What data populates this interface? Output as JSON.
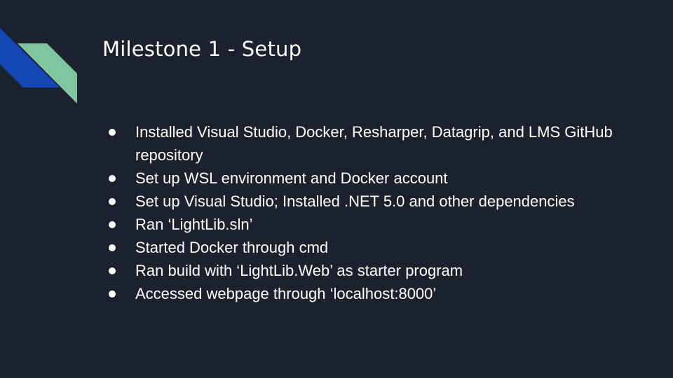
{
  "slide": {
    "title": "Milestone 1 - Setup",
    "bullets": [
      "Installed Visual Studio, Docker, Resharper, Datagrip, and LMS GitHub repository",
      "Set up WSL environment and Docker account",
      "Set up Visual Studio; Installed .NET 5.0 and other dependencies",
      "Ran ‘LightLib.sln’",
      "Started Docker through cmd",
      "Ran build with ‘LightLib.Web’ as starter program",
      "Accessed webpage through ‘localhost:8000’"
    ]
  },
  "colors": {
    "background": "#1c222d",
    "text": "#ffffff",
    "accent_blue": "#1446b4",
    "accent_green": "#7fc5a0"
  }
}
